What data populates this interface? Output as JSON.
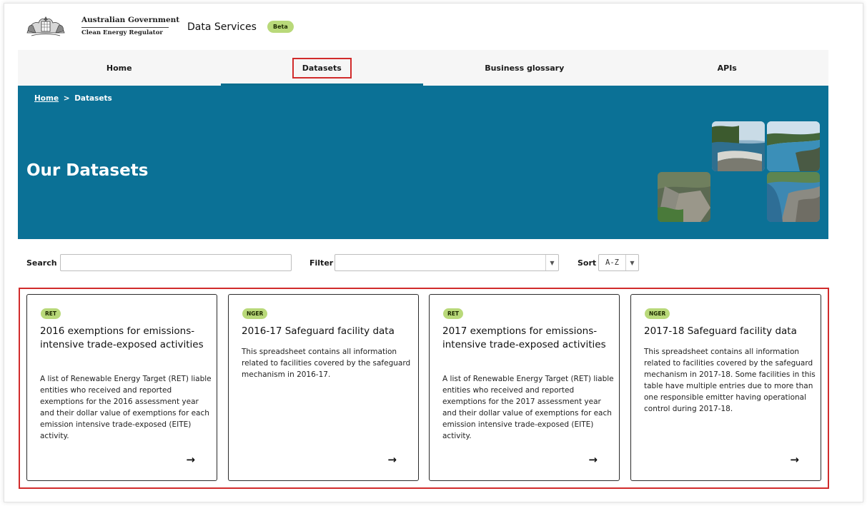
{
  "header": {
    "gov_line1": "Australian Government",
    "gov_line2": "Clean Energy Regulator",
    "service_name": "Data Services",
    "beta_badge": "Beta",
    "crest_icon": "commonwealth-coat-of-arms-icon"
  },
  "nav": {
    "items": [
      {
        "label": "Home"
      },
      {
        "label": "Datasets",
        "active": true
      },
      {
        "label": "Business glossary"
      },
      {
        "label": "APIs"
      }
    ]
  },
  "hero": {
    "breadcrumb": {
      "home": "Home",
      "separator": ">",
      "current": "Datasets"
    },
    "title": "Our Datasets",
    "background_color": "#0b7196"
  },
  "controls": {
    "search_label": "Search",
    "search_value": "",
    "filter_label": "Filter",
    "filter_value": "",
    "sort_label": "Sort",
    "sort_value": "A-Z",
    "dropdown_icon": "triangle-down-icon"
  },
  "cards": [
    {
      "tag": "RET",
      "title": "2016 exemptions for emissions-intensive trade-exposed activities",
      "description": "A list of Renewable Energy Target (RET) liable entities who received and reported exemptions for the 2016 assessment year and their dollar value of exemptions for each emission intensive trade-exposed (EITE) activity.",
      "arrow": "→"
    },
    {
      "tag": "NGER",
      "title": "2016-17 Safeguard facility data",
      "description": "This spreadsheet contains all information related to facilities covered by the safeguard mechanism in 2016-17.",
      "arrow": "→"
    },
    {
      "tag": "RET",
      "title": "2017 exemptions for emissions-intensive trade-exposed activities",
      "description": "A list of Renewable Energy Target (RET) liable entities who received and reported exemptions for the 2017 assessment year and their dollar value of exemptions for each emission intensive trade-exposed (EITE) activity.",
      "arrow": "→"
    },
    {
      "tag": "NGER",
      "title": "2017-18 Safeguard facility data",
      "description": "This spreadsheet contains all information related to facilities covered by the safeguard mechanism in 2017-18. Some facilities in this table have multiple entries due to more than one responsible emitter having operational control during 2017-18.",
      "arrow": "→"
    }
  ],
  "colors": {
    "accent": "#0b7196",
    "badge": "#b9d97a",
    "highlight": "#d12b2b"
  }
}
